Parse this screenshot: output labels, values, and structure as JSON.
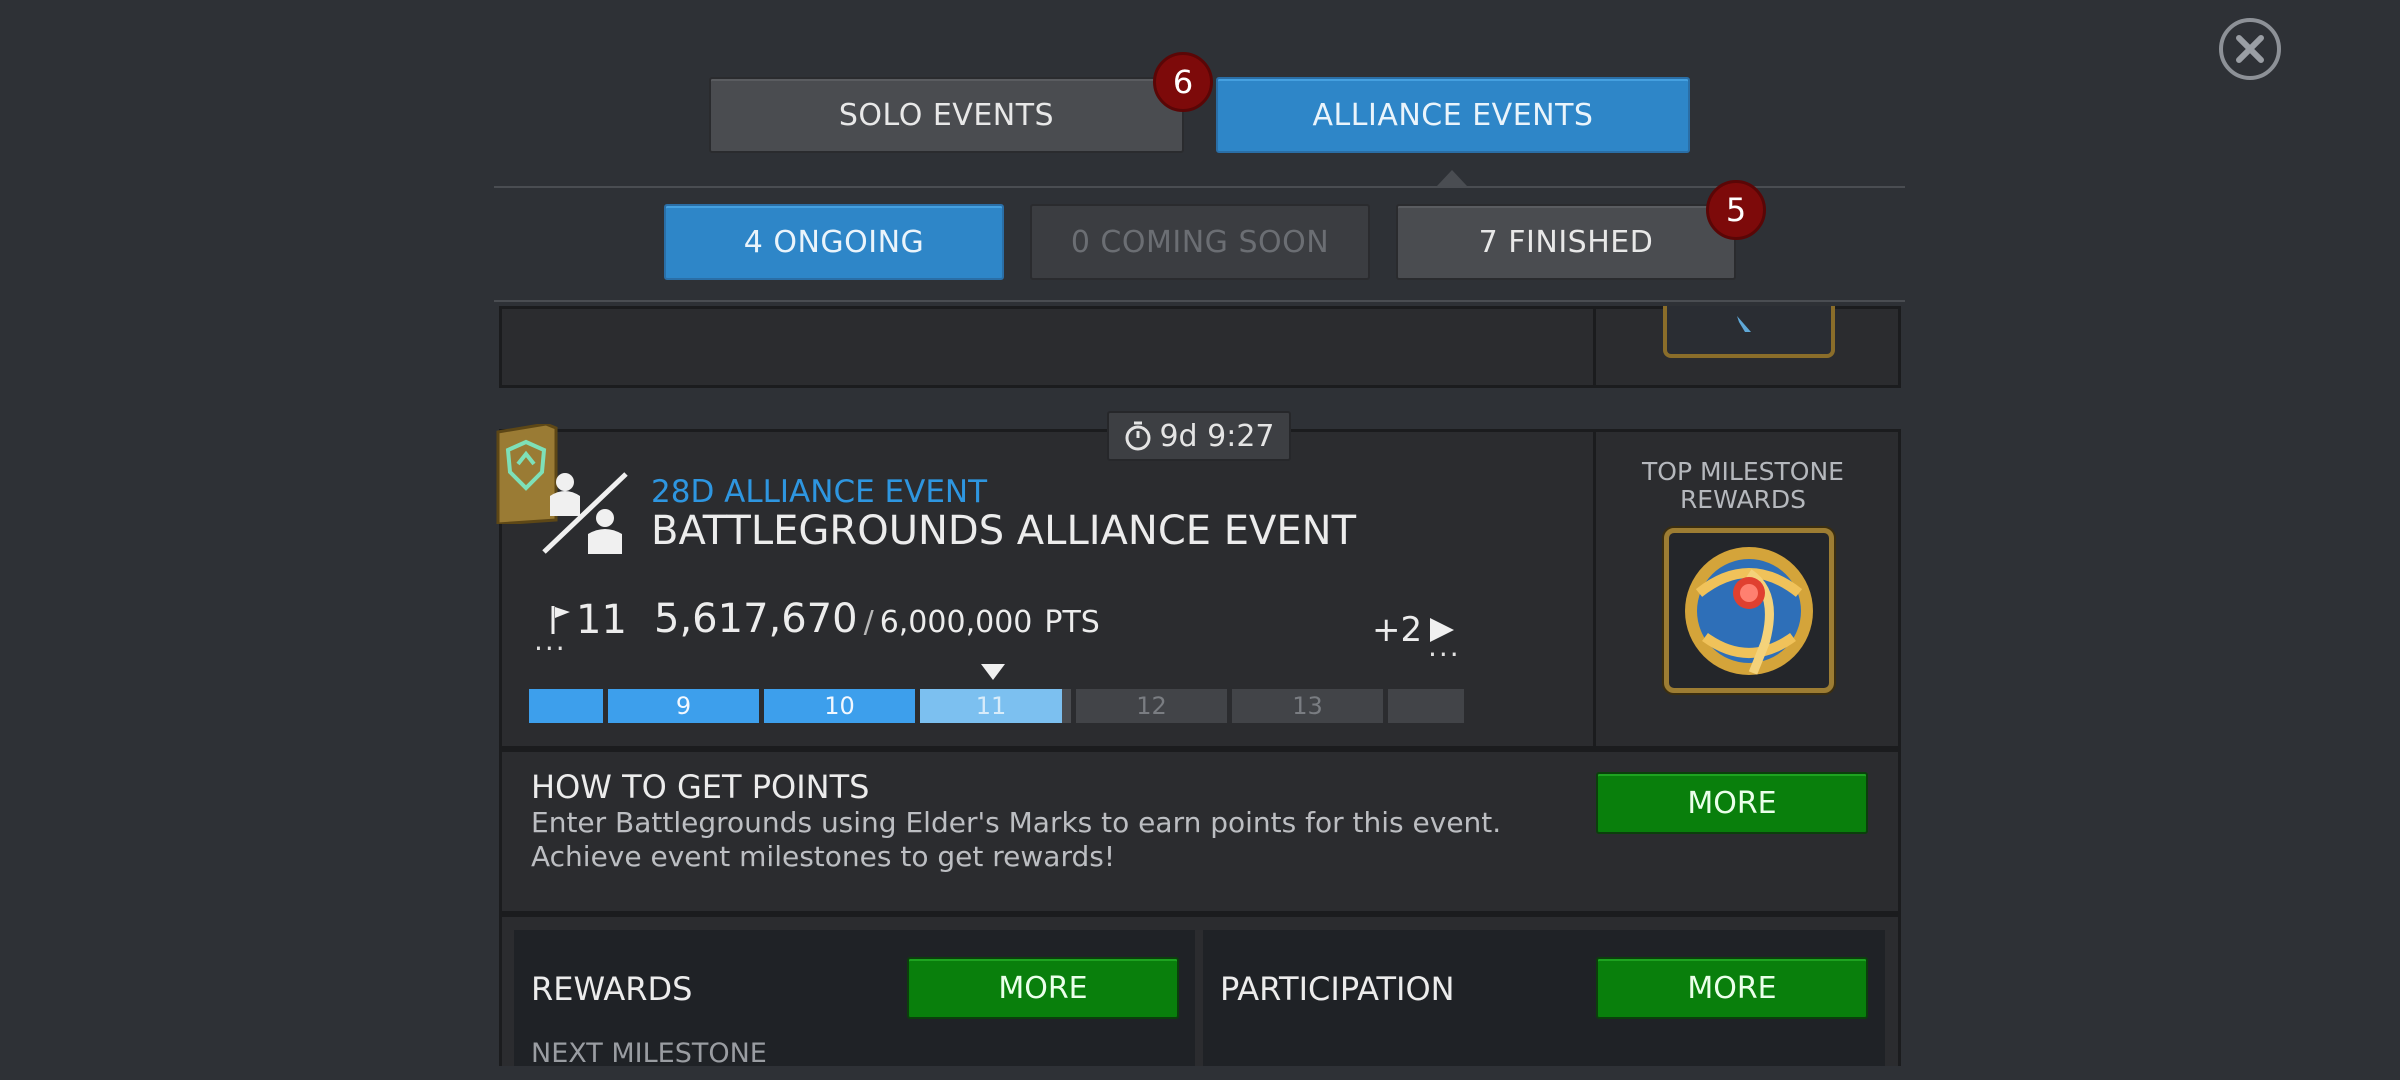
{
  "tabs": {
    "solo_label": "SOLO EVENTS",
    "solo_badge": "6",
    "alliance_label": "ALLIANCE EVENTS"
  },
  "filters": {
    "ongoing_label": "4 ONGOING",
    "coming_soon_label": "0 COMING SOON",
    "finished_label": "7 FINISHED",
    "finished_badge": "5"
  },
  "event": {
    "timer": "9d 9:27",
    "category": "28D ALLIANCE EVENT",
    "title": "BATTLEGROUNDS ALLIANCE EVENT",
    "milestone_flag": "11",
    "points_current": "5,617,670",
    "points_separator": "/",
    "points_target": "6,000,000",
    "points_unit": "PTS",
    "next_more": "+2",
    "progress_segments": [
      "",
      "9",
      "10",
      "11",
      "12",
      "13",
      ""
    ],
    "current_milestone": 11,
    "top_rewards_label": "TOP MILESTONE REWARDS"
  },
  "how_to": {
    "heading": "HOW TO GET POINTS",
    "description": "Enter Battlegrounds using Elder's Marks to earn points for this event. Achieve event milestones to get rewards!",
    "more_label": "MORE"
  },
  "rewards": {
    "heading": "REWARDS",
    "more_label": "MORE",
    "next_milestone_label": "NEXT MILESTONE"
  },
  "participation": {
    "heading": "PARTICIPATION",
    "more_label": "MORE"
  },
  "colors": {
    "accent_blue": "#2e86c8",
    "green_button": "#097f0c",
    "badge_red": "#7d0a0a"
  }
}
